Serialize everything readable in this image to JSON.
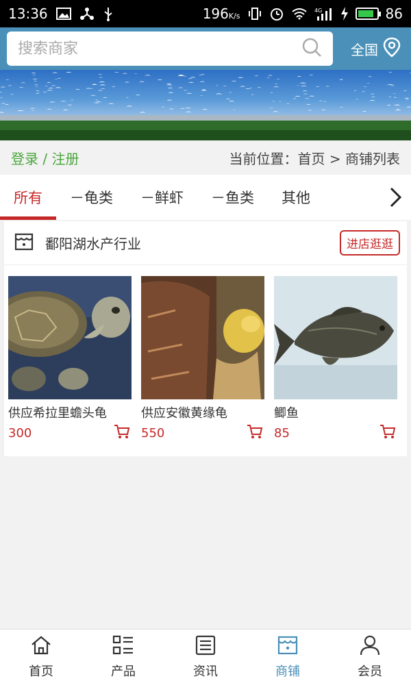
{
  "status_bar": {
    "time": "13:36",
    "net_speed": "196",
    "net_unit": "K/s",
    "network": "4G",
    "battery_level": 0.86,
    "battery_text": "86"
  },
  "search": {
    "placeholder": "搜索商家",
    "region_label": "全国"
  },
  "breadcrumb": {
    "login_text": "登录 / 注册",
    "location_text": "当前位置：首页 > 商铺列表"
  },
  "tabs": [
    {
      "label": "所有",
      "active": true
    },
    {
      "label": "－龟类",
      "active": false
    },
    {
      "label": "－鲜虾",
      "active": false
    },
    {
      "label": "－鱼类",
      "active": false
    },
    {
      "label": "其他",
      "active": false
    }
  ],
  "shop": {
    "name": "鄱阳湖水产行业",
    "enter_label": "进店逛逛",
    "products": [
      {
        "name": "供应希拉里蟾头龟",
        "price": "300"
      },
      {
        "name": "供应安徽黄缘龟",
        "price": "550"
      },
      {
        "name": "鲫鱼",
        "price": "85"
      }
    ]
  },
  "bottom_nav": [
    {
      "label": "首页",
      "icon": "home-icon",
      "active": false
    },
    {
      "label": "产品",
      "icon": "list-icon",
      "active": false
    },
    {
      "label": "资讯",
      "icon": "news-icon",
      "active": false
    },
    {
      "label": "商铺",
      "icon": "store-icon",
      "active": true
    },
    {
      "label": "会员",
      "icon": "user-icon",
      "active": false
    }
  ],
  "colors": {
    "header_bg": "#4a90b8",
    "accent_red": "#c62828",
    "login_green": "#4aa63c"
  }
}
